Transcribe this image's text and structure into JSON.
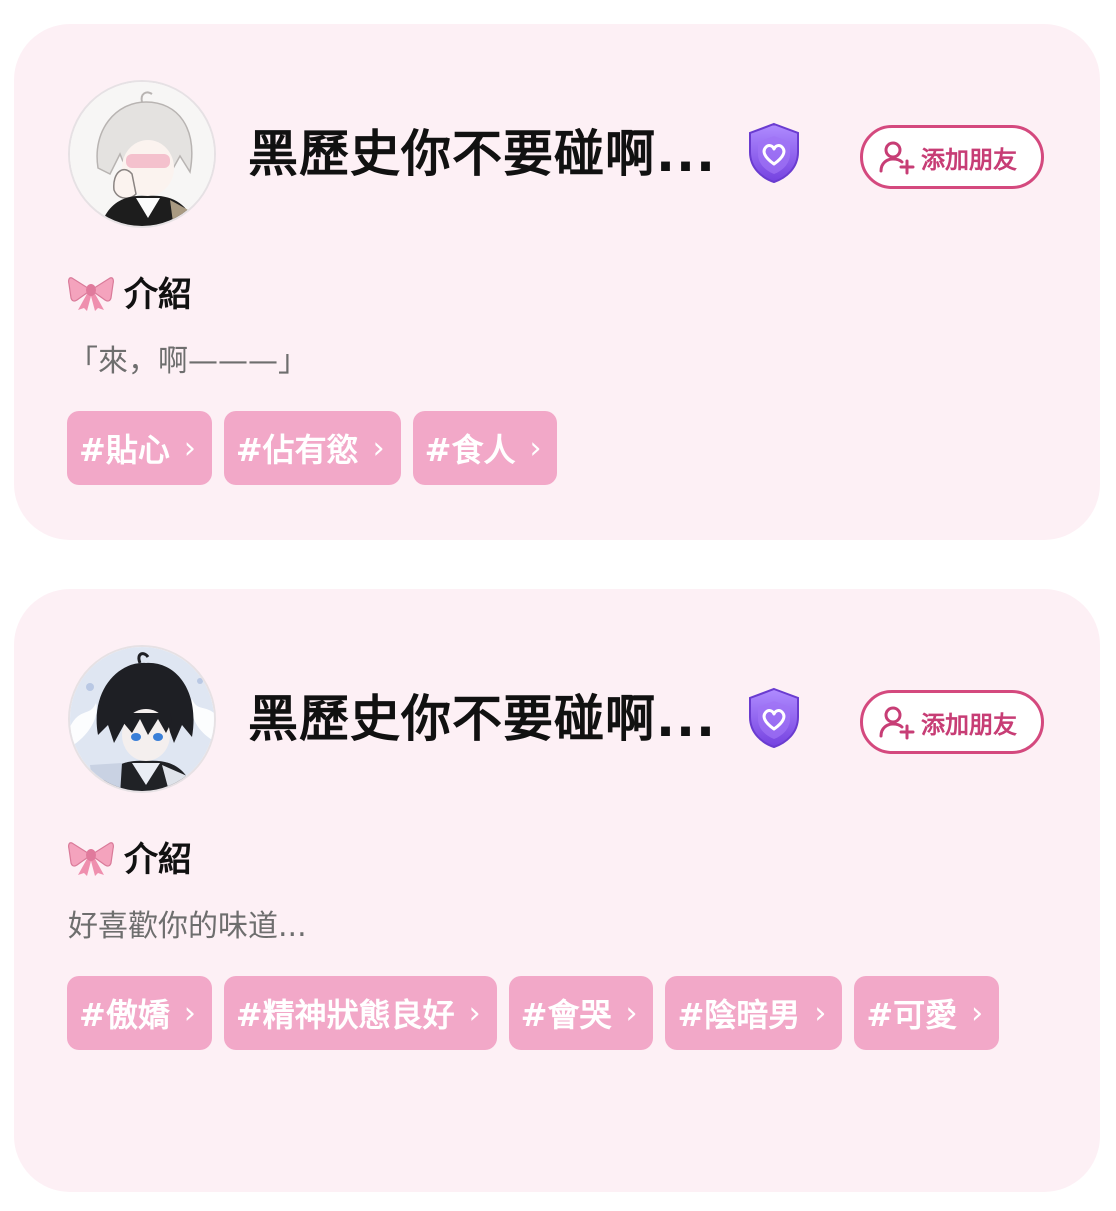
{
  "cards": [
    {
      "name": "黑歷史你不要碰啊...",
      "add_friend_label": "添加朋友",
      "intro_label": "介紹",
      "intro_text": "「來，啊———」",
      "tags": [
        "#貼心",
        "#佔有慾",
        "#食人"
      ]
    },
    {
      "name": "黑歷史你不要碰啊...",
      "add_friend_label": "添加朋友",
      "intro_label": "介紹",
      "intro_text": "好喜歡你的味道...",
      "tags": [
        "#傲嬌",
        "#精神狀態良好",
        "#會哭",
        "#陰暗男",
        "#可愛"
      ]
    }
  ],
  "icons": {
    "badge": "purple-shield-heart-icon",
    "add_friend": "user-plus-icon",
    "intro": "pink-bow-icon",
    "tag_arrow": "chevron-right-icon"
  },
  "colors": {
    "card_bg": "#fdf0f5",
    "tag_bg": "#f2a8c8",
    "accent": "#d4497e",
    "badge": "#8e5cf0"
  },
  "tag_chevron": "›"
}
